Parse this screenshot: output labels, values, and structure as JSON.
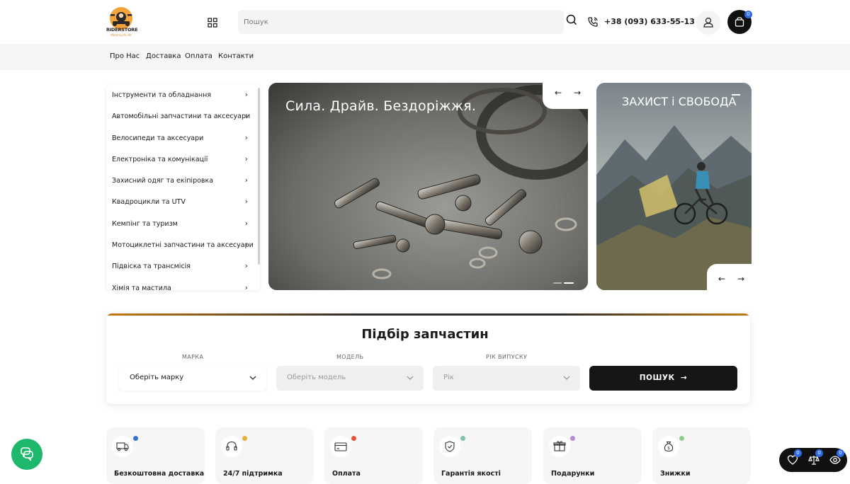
{
  "brand": {
    "logo_text": "RIDERSTORE",
    "logo_sub": "Motorcycle life"
  },
  "header": {
    "search_placeholder": "Пошук",
    "phone": "+38 (093) 633-55-13",
    "cart_count": "0"
  },
  "nav": {
    "items": [
      "Про Нас",
      "Доставка",
      "Оплата",
      "Контакти"
    ]
  },
  "categories": [
    "Інструменти та обладнання",
    "Автомобільні запчастини та аксесуари",
    "Велосипеди та аксесуари",
    "Електроніка та комунікації",
    "Захисний одяг та екіпіровка",
    "Квадроцикли та UTV",
    "Кемпінг та туризм",
    "Мотоциклетні запчастини та аксесуари",
    "Підвіска та трансмісія",
    "Хімія та мастила"
  ],
  "hero": {
    "title": "Сила. Драйв. Бездоріжжя.",
    "prev": "←",
    "next": "→"
  },
  "side_banner": {
    "title": "ЗАХИСТ і СВОБОДА",
    "prev": "←",
    "next": "→"
  },
  "parts_picker": {
    "title": "Підбір запчастин",
    "brand_label": "МАРКА",
    "brand_value": "Оберіть марку",
    "model_label": "МОДЕЛЬ",
    "model_value": "Оберіть модель",
    "year_label": "РІК ВИПУСКУ",
    "year_value": "Рік",
    "submit_label": "ПОШУК"
  },
  "features": [
    {
      "label": "Безкоштовна доставка",
      "dot": "#3b6fd8"
    },
    {
      "label": "24/7 підтримка",
      "dot": "#e4b23a"
    },
    {
      "label": "Оплата",
      "dot": "#e0533d"
    },
    {
      "label": "Гарантія якості",
      "dot": "#7fc4a8"
    },
    {
      "label": "Подарунки",
      "dot": "#b98bd6"
    },
    {
      "label": "Знижки",
      "dot": "#8dcf88"
    }
  ],
  "floating": {
    "wishlist_count": "0",
    "compare_count": "0",
    "viewed_count": "0"
  },
  "colors": {
    "accent": "#111111",
    "badge": "#2d6be4",
    "chat": "#1db86b"
  }
}
